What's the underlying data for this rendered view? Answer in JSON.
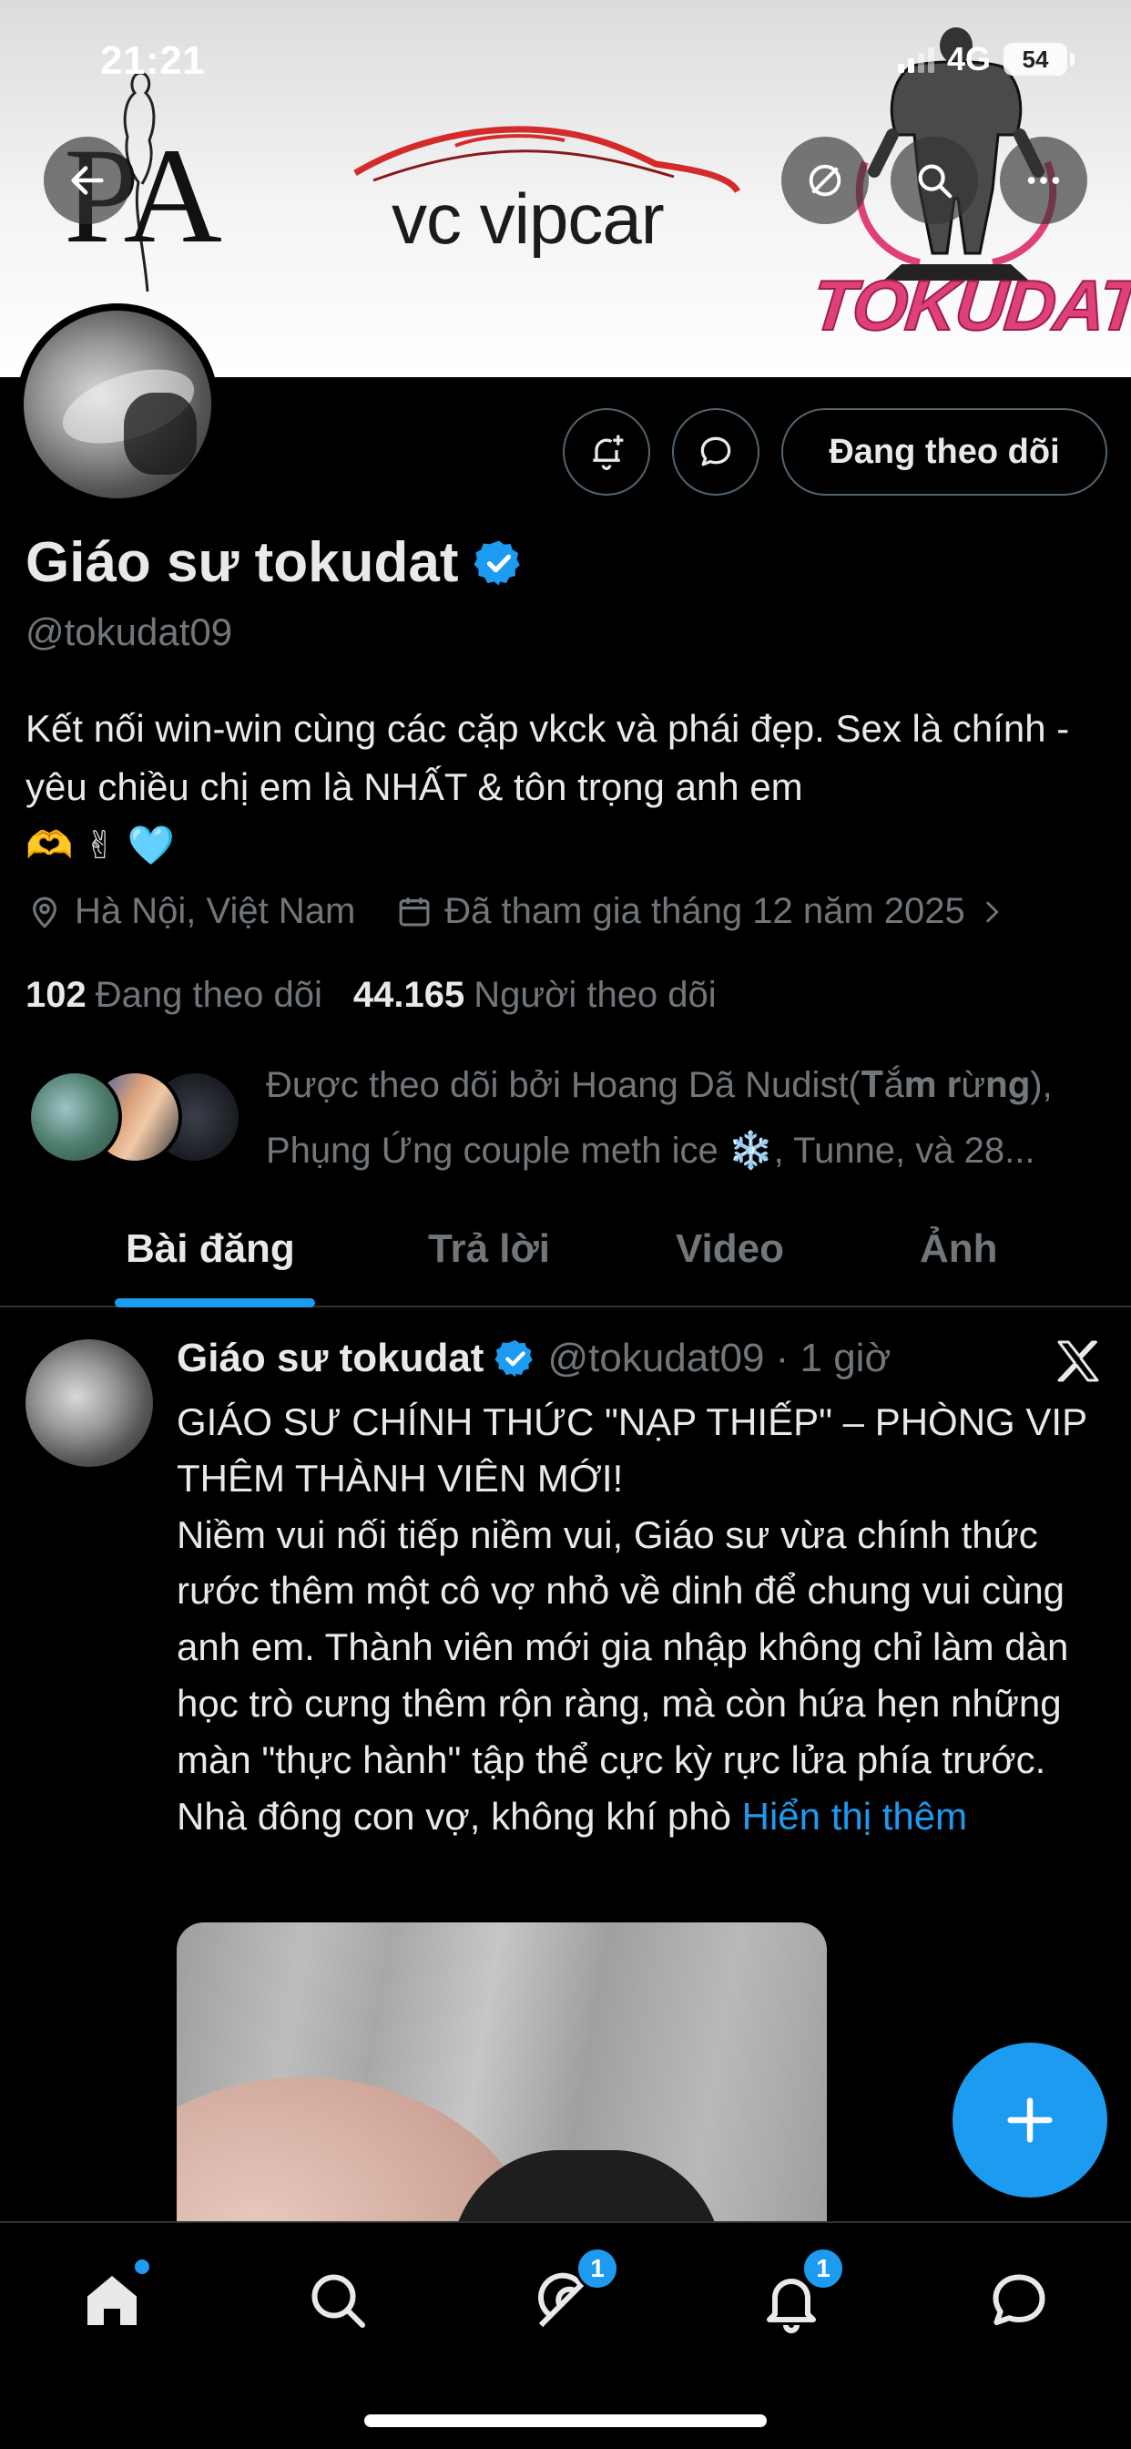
{
  "status_bar": {
    "time": "21:21",
    "network": "4G",
    "battery": "54"
  },
  "banner": {
    "logos": [
      "PA",
      "vc vipcar",
      "TOKUDAT"
    ],
    "buttons": [
      "back-arrow-icon",
      "translate-off-icon",
      "search-icon",
      "more-icon"
    ]
  },
  "profile": {
    "display_name": "Giáo sư tokudat",
    "handle": "@tokudat09",
    "bio_text": "Kết nối win-win cùng các cặp vkck và phái đẹp. Sex là chính - yêu chiều chị em là NHẤT & tôn trọng anh em",
    "bio_emojis": [
      "🫶",
      "✌",
      "🩵"
    ],
    "location": "Hà Nội, Việt Nam",
    "joined": "Đã tham gia tháng 12 năm 2025",
    "following_count": "102",
    "following_label": "Đang theo dõi",
    "followers_count": "44.165",
    "followers_label": "Người theo dõi",
    "followed_by": "Được theo dõi bởi Hoang Dã Nudist(𝐓ắ𝐦 𝐫ừ𝐧𝐠), Phụng Ứng couple meth ice ❄️, Tunne, và 28..."
  },
  "actions": {
    "follow_button": "Đang theo dõi"
  },
  "tabs": [
    {
      "label": "Bài đăng",
      "active": true
    },
    {
      "label": "Trả lời",
      "active": false
    },
    {
      "label": "Video",
      "active": false
    },
    {
      "label": "Ảnh",
      "active": false
    }
  ],
  "post": {
    "author": "Giáo sư tokudat",
    "handle_time": "@tokudat09 · 1 giờ",
    "line1": "GIÁO SƯ CHÍNH THỨC \"NẠP THIẾP\" – PHÒNG VIP THÊM THÀNH VIÊN MỚI!",
    "line2": "Niềm vui nối tiếp niềm vui, Giáo sư vừa chính thức rước thêm một cô vợ nhỏ về dinh để chung vui cùng anh em. Thành viên mới gia nhập không chỉ làm dàn học trò cưng thêm rộn ràng, mà còn hứa hẹn những màn \"thực hành\" tập thể cực kỳ rực lửa phía trước.",
    "line3": "Nhà đông con vợ, không khí phò",
    "show_more": "Hiển thị thêm"
  },
  "bottom_nav": {
    "items": [
      "home-icon",
      "search-icon",
      "grok-icon",
      "bell-icon",
      "messages-icon"
    ],
    "grok_badge": "1",
    "notifications_badge": "1"
  },
  "colors": {
    "accent": "#1d9bf0",
    "background": "#000000",
    "muted": "#71767b",
    "text": "#e7e9ea"
  }
}
